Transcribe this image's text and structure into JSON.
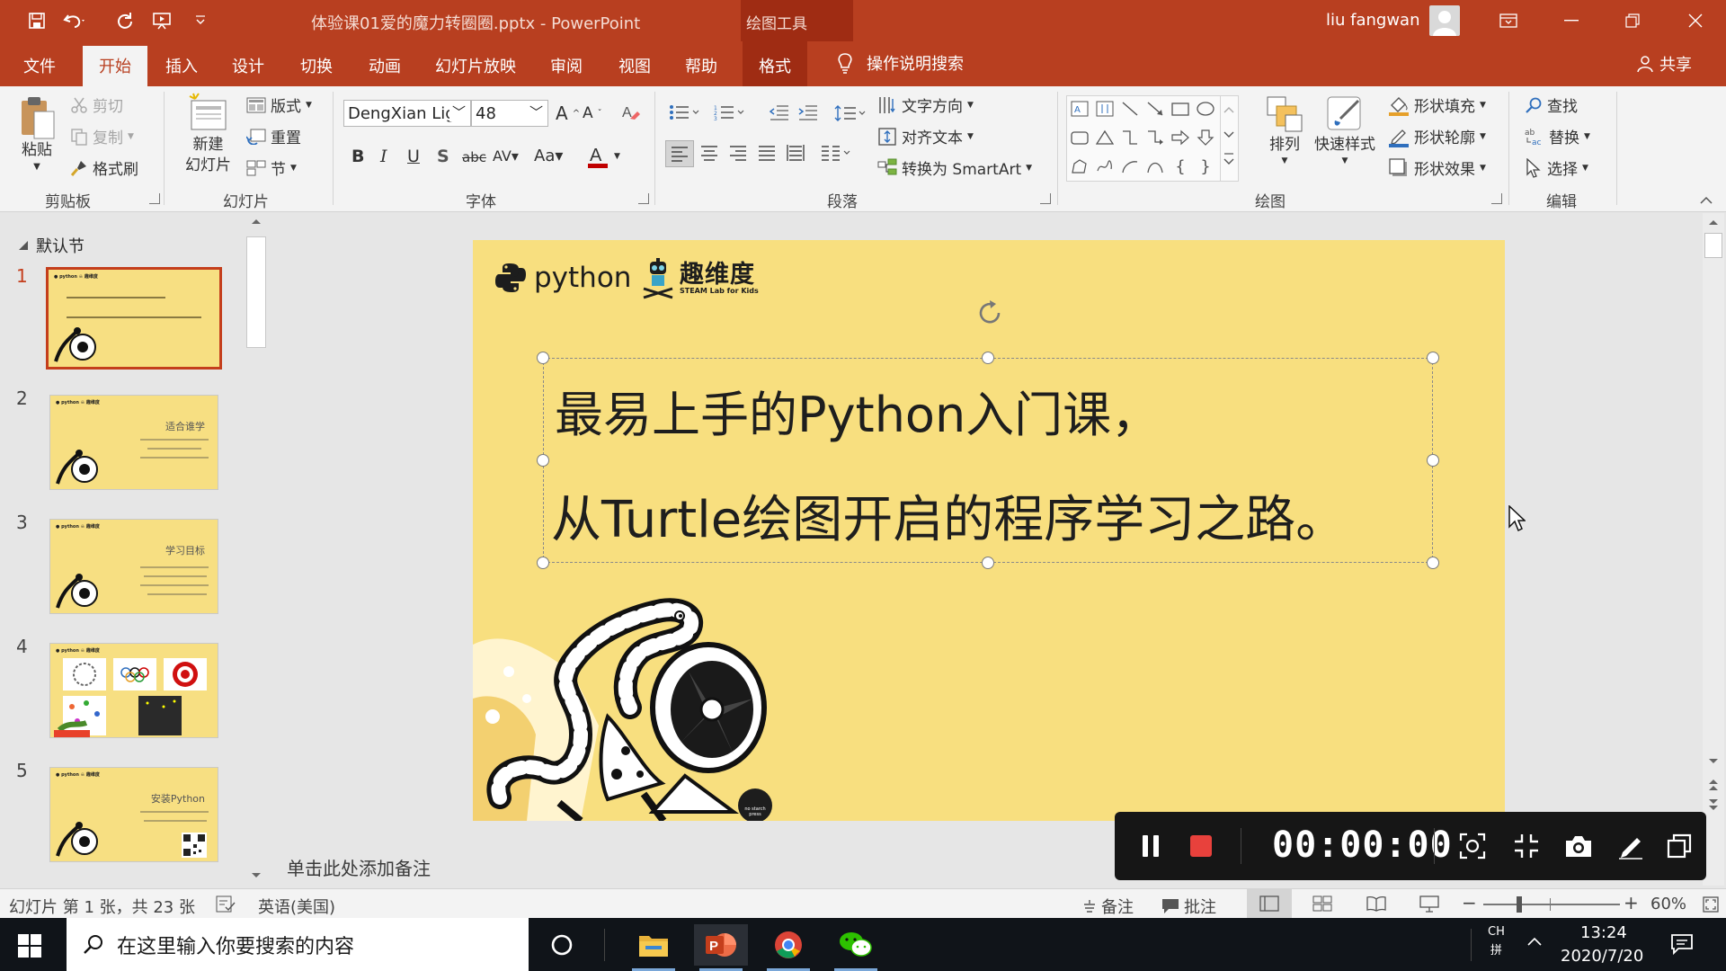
{
  "titlebar": {
    "document_title": "体验课01爱的魔力转圈圈.pptx  -  PowerPoint",
    "context_tools": "绘图工具",
    "user_name": "liu fangwan",
    "colors": {
      "bar": "#b83f20",
      "context": "#9f2c13"
    }
  },
  "tabs": {
    "file": "文件",
    "home": "开始",
    "insert": "插入",
    "design": "设计",
    "transitions": "切换",
    "animations": "动画",
    "slideshow": "幻灯片放映",
    "review": "审阅",
    "view": "视图",
    "help": "帮助",
    "format": "格式",
    "tell_me": "操作说明搜索",
    "share": "共享"
  },
  "ribbon": {
    "clipboard": {
      "paste": "粘贴",
      "cut": "剪切",
      "copy": "复制",
      "format_painter": "格式刷",
      "label": "剪贴板"
    },
    "slides": {
      "new_slide_1": "新建",
      "new_slide_2": "幻灯片",
      "layout": "版式",
      "reset": "重置",
      "section": "节",
      "label": "幻灯片"
    },
    "font": {
      "font_name": "DengXian Lig",
      "font_size": "48",
      "label": "字体"
    },
    "paragraph": {
      "text_direction": "文字方向",
      "align_text": "对齐文本",
      "smartart": "转换为 SmartArt",
      "label": "段落"
    },
    "drawing": {
      "arrange": "排列",
      "quick_styles": "快速样式",
      "shape_fill": "形状填充",
      "shape_outline": "形状轮廓",
      "shape_effects": "形状效果",
      "label": "绘图"
    },
    "editing": {
      "find": "查找",
      "replace": "替换",
      "select": "选择",
      "label": "编辑"
    }
  },
  "slides_panel": {
    "section": "默认节",
    "slides": [
      {
        "num": "1",
        "title": ""
      },
      {
        "num": "2",
        "title": "适合谁学"
      },
      {
        "num": "3",
        "title": "学习目标"
      },
      {
        "num": "4",
        "title": ""
      },
      {
        "num": "5",
        "title": "安装Python"
      }
    ]
  },
  "slide": {
    "logo_python": "python",
    "logo_brand": "趣维度",
    "logo_brand_sub": "STEAM Lab for Kids",
    "line1": "最易上手的Python入门课，",
    "line2": "从Turtle绘图开启的程序学习之路。",
    "badge": "no starch press",
    "background": "#f8df7f"
  },
  "notes": {
    "placeholder": "单击此处添加备注"
  },
  "recorder": {
    "time": "00:00:00"
  },
  "statusbar": {
    "slide_info": "幻灯片 第 1 张，共 23 张",
    "language": "英语(美国)",
    "notes": "备注",
    "comments": "批注",
    "zoom": "60%"
  },
  "taskbar": {
    "search_placeholder": "在这里输入你要搜索的内容",
    "ime_1": "CH",
    "ime_2": "拼",
    "time": "13:24",
    "date": "2020/7/20"
  }
}
